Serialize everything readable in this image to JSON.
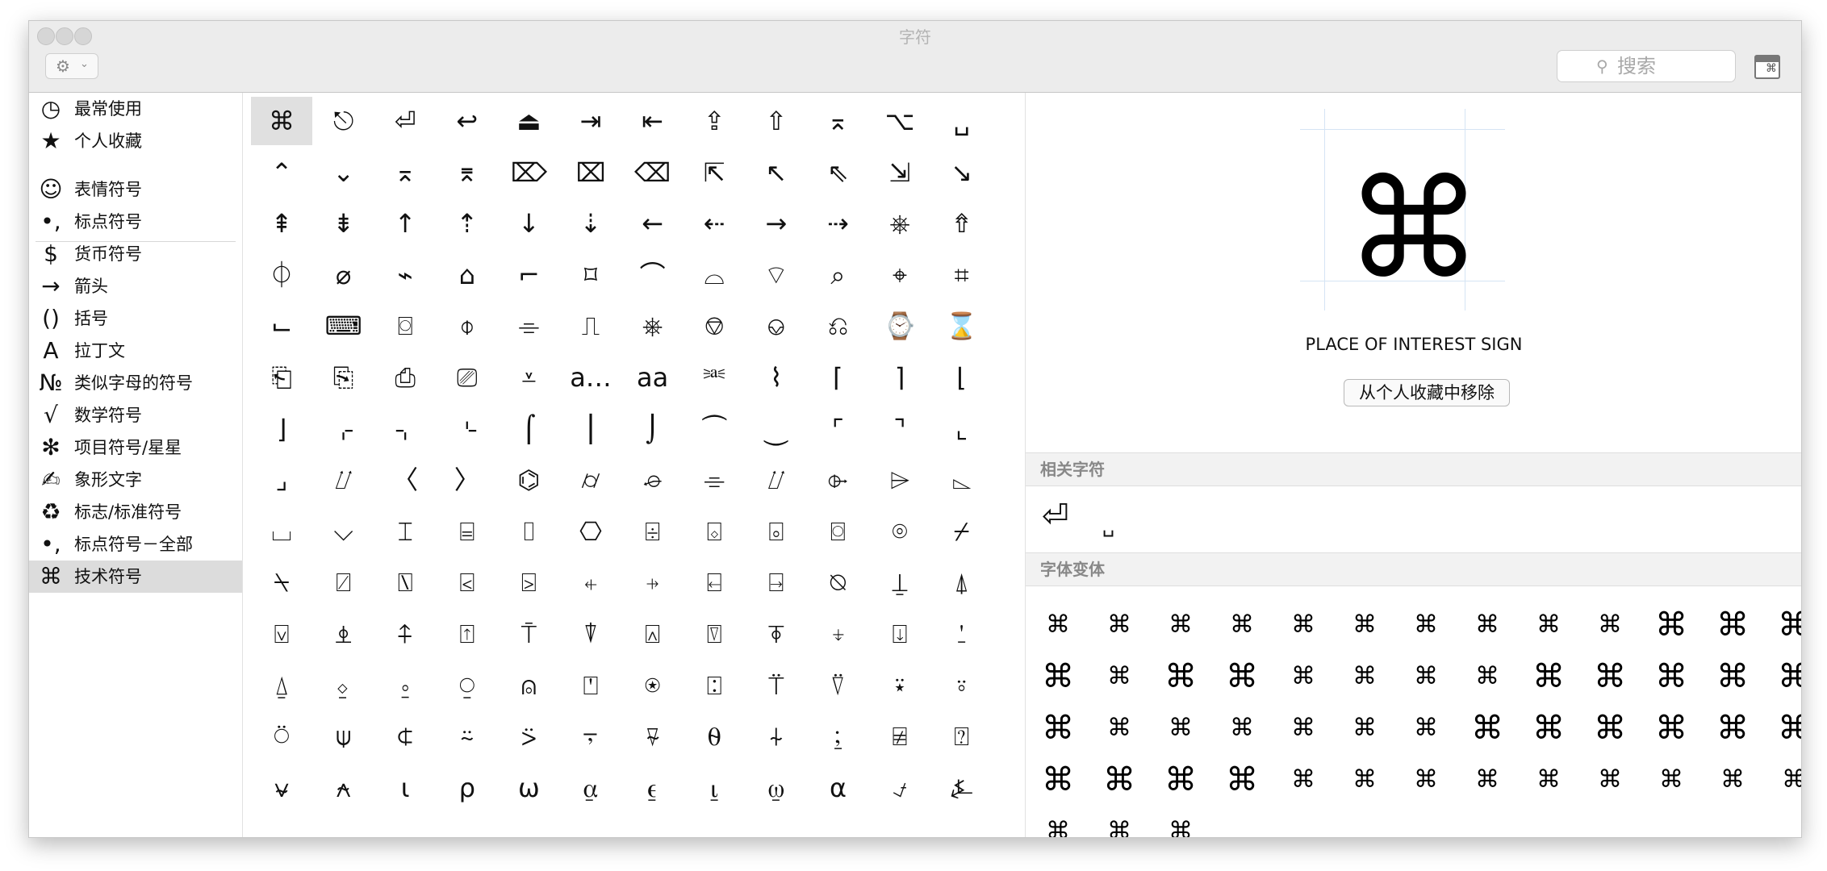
{
  "window": {
    "title": "字符"
  },
  "toolbar": {
    "gear_glyph": "⚙",
    "chevron_glyph": "⌄",
    "search_placeholder": "搜索",
    "search_glyph": "⚲",
    "view_glyph": "⌘"
  },
  "sidebar": {
    "items": [
      {
        "icon": "clock-icon",
        "glyph": "◷",
        "label": "最常使用"
      },
      {
        "icon": "star-icon",
        "glyph": "★",
        "label": "个人收藏"
      },
      {
        "icon": "smiley-icon",
        "glyph": "☺",
        "label": "表情符号"
      },
      {
        "icon": "punctuation-icon",
        "glyph": "•,",
        "label": "标点符号"
      },
      {
        "icon": "dollar-icon",
        "glyph": "$",
        "label": "货币符号"
      },
      {
        "icon": "arrow-icon",
        "glyph": "→",
        "label": "箭头"
      },
      {
        "icon": "parentheses-icon",
        "glyph": "()",
        "label": "括号"
      },
      {
        "icon": "latin-a-icon",
        "glyph": "A",
        "label": "拉丁文"
      },
      {
        "icon": "numero-icon",
        "glyph": "№",
        "label": "类似字母的符号"
      },
      {
        "icon": "sqrt-icon",
        "glyph": "√",
        "label": "数学符号"
      },
      {
        "icon": "asterisk-icon",
        "glyph": "✻",
        "label": "项目符号/星星"
      },
      {
        "icon": "writing-hand-icon",
        "glyph": "✍",
        "label": "象形文字"
      },
      {
        "icon": "recycle-icon",
        "glyph": "♻",
        "label": "标志/标准符号"
      },
      {
        "icon": "punctuation-all-icon",
        "glyph": "•,",
        "label": "标点符号－全部"
      },
      {
        "icon": "command-icon",
        "glyph": "⌘",
        "label": "技术符号"
      }
    ],
    "selected": "技术符号"
  },
  "grid": {
    "rows": [
      [
        "⌘",
        "⎋",
        "⏎",
        "↩",
        "⏏",
        "⇥",
        "⇤",
        "⇪",
        "⇧",
        "⌅",
        "⌥",
        "␣"
      ],
      [
        "⌃",
        "⌄",
        "⌅",
        "⌆",
        "⌦",
        "⌧",
        "⌫",
        "⇱",
        "↖",
        "⇖",
        "⇲",
        "↘"
      ],
      [
        "⇞",
        "⇟",
        "↑",
        "⇡",
        "↓",
        "⇣",
        "←",
        "⇠",
        "→",
        "⇢",
        "⎈",
        "⇮"
      ],
      [
        "⏀",
        "⌀",
        "⌁",
        "⌂",
        "⌐",
        "⌑",
        "⌒",
        "⌓",
        "⌔",
        "⌕",
        "⌖",
        "⌗"
      ],
      [
        "⌙",
        "⌨",
        "⌼",
        "⌽",
        "⌯",
        "⎍",
        "⎈",
        "⎊",
        "⎉",
        "⎌",
        "⌚",
        "⌛"
      ],
      [
        "⎗",
        "⎘",
        "⎙",
        "⎚",
        "⩡",
        "a…",
        "aa",
        "⎃",
        "⌇",
        "⌈",
        "⌉",
        "⌊"
      ],
      [
        "⌋",
        "⌌",
        "⌍",
        "⌎",
        "⌠",
        "⎮",
        "⌡",
        "⏜",
        "⏝",
        "⌜",
        "⌝",
        "⌞"
      ],
      [
        "⌟",
        "⌰",
        "〈",
        "〉",
        "⌬",
        "⌭",
        "⌮",
        "⌯",
        "⌰",
        "⌱",
        "⌲",
        "⌳"
      ],
      [
        "⌴",
        "⌵",
        "⌶",
        "⌸",
        "⌷",
        "⎔",
        "⌹",
        "⌺",
        "⌻",
        "⌼",
        "⌾",
        "⌿"
      ],
      [
        "⍀",
        "⍁",
        "⍂",
        "⍃",
        "⍄",
        "⍅",
        "⍆",
        "⍇",
        "⍈",
        "⍉",
        "⍊",
        "⍋"
      ],
      [
        "⍌",
        "⍎",
        "⍏",
        "⍐",
        "⍑",
        "⍒",
        "⍓",
        "⍔",
        "⍕",
        "⍖",
        "⍗",
        "⍘"
      ],
      [
        "⍙",
        "⍚",
        "⍛",
        "⍜",
        "⍝",
        "⍞",
        "⍟",
        "⍠",
        "⍡",
        "⍢",
        "⍣",
        "⍤"
      ],
      [
        "⍥",
        "⍦",
        "⍧",
        "⍨",
        "⍩",
        "⍪",
        "⍫",
        "⍬",
        "⍭",
        "⍮",
        "⍯",
        "⍰"
      ],
      [
        "⍱",
        "⍲",
        "⍳",
        "⍴",
        "⍵",
        "⍶",
        "⍷",
        "⍸",
        "⍹",
        "⍺",
        "⍻",
        "⍼"
      ]
    ]
  },
  "detail": {
    "glyph": "⌘",
    "name": "PLACE OF INTEREST SIGN",
    "favorite_button": "从个人收藏中移除",
    "related_header": "相关字符",
    "related": [
      "⏎",
      "␣"
    ],
    "variants_header": "字体变体",
    "variants": [
      "⌘",
      "⌘",
      "⌘",
      "⌘",
      "⌘",
      "⌘",
      "⌘",
      "⌘",
      "⌘",
      "⌘",
      "⌘",
      "⌘",
      "⌘",
      "⌘",
      "⌘",
      "⌘",
      "⌘",
      "⌘",
      "⌘",
      "⌘",
      "⌘",
      "⌘",
      "⌘",
      "⌘",
      "⌘",
      "⌘",
      "⌘",
      "⌘",
      "⌘",
      "⌘",
      "⌘",
      "⌘",
      "⌘",
      "⌘",
      "⌘",
      "⌘",
      "⌘",
      "⌘",
      "⌘",
      "⌘",
      "⌘",
      "⌘",
      "⌘",
      "⌘",
      "⌘",
      "⌘",
      "⌘",
      "⌘",
      "⌘",
      "⌘",
      "⌘",
      "⌘",
      "⌘",
      "⌘",
      "⌘"
    ]
  }
}
